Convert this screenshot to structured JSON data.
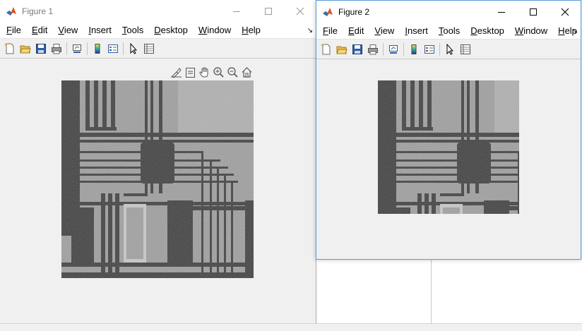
{
  "figure1": {
    "title": "Figure 1",
    "menu": [
      {
        "label": "File",
        "acc": "F",
        "rest": "ile"
      },
      {
        "label": "Edit",
        "acc": "E",
        "rest": "dit"
      },
      {
        "label": "View",
        "acc": "V",
        "rest": "iew"
      },
      {
        "label": "Insert",
        "acc": "I",
        "rest": "nsert"
      },
      {
        "label": "Tools",
        "acc": "T",
        "rest": "ools"
      },
      {
        "label": "Desktop",
        "acc": "D",
        "rest": "esktop"
      },
      {
        "label": "Window",
        "acc": "W",
        "rest": "indow"
      },
      {
        "label": "Help",
        "acc": "H",
        "rest": "elp"
      }
    ],
    "menu_overflow": "↘"
  },
  "figure2": {
    "title": "Figure 2",
    "menu": [
      {
        "label": "File",
        "acc": "F",
        "rest": "ile"
      },
      {
        "label": "Edit",
        "acc": "E",
        "rest": "dit"
      },
      {
        "label": "View",
        "acc": "V",
        "rest": "iew"
      },
      {
        "label": "Insert",
        "acc": "I",
        "rest": "nsert"
      },
      {
        "label": "Tools",
        "acc": "T",
        "rest": "ools"
      },
      {
        "label": "Desktop",
        "acc": "D",
        "rest": "esktop"
      },
      {
        "label": "Window",
        "acc": "W",
        "rest": "indow"
      },
      {
        "label": "Help",
        "acc": "H",
        "rest": "elp"
      }
    ],
    "menu_overflow": "↘"
  },
  "toolbar_icons": [
    "new-figure-icon",
    "open-file-icon",
    "save-icon",
    "print-icon",
    "link-plot-icon",
    "insert-colorbar-icon",
    "insert-legend-icon",
    "edit-plot-icon",
    "property-inspector-icon"
  ],
  "axes_toolbar_icons": [
    "brush-icon",
    "data-tips-icon",
    "pan-icon",
    "zoom-in-icon",
    "zoom-out-icon",
    "restore-view-icon"
  ],
  "colors": {
    "window_bg": "#f0f0f0",
    "title_bg": "#ffffff",
    "inactive_title": "#7a7a7a",
    "active_border": "#5d9bd4",
    "matlab_orange": "#d9531e"
  },
  "images": {
    "figure1_image": "grayscale-integrated-circuit-micrograph",
    "figure2_image": "grayscale-integrated-circuit-micrograph-cropped"
  }
}
